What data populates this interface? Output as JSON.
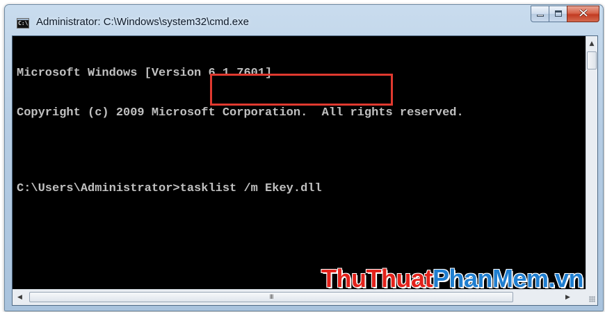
{
  "window": {
    "title": "Administrator: C:\\Windows\\system32\\cmd.exe",
    "icon": "cmd-icon",
    "icon_text": "C:\\",
    "buttons": {
      "minimize": "minimize-icon",
      "maximize": "maximize-icon",
      "close": "close-icon"
    }
  },
  "console": {
    "lines": [
      "Microsoft Windows [Version 6.1.7601]",
      "Copyright (c) 2009 Microsoft Corporation.  All rights reserved."
    ],
    "prompt": "C:\\Users\\Administrator>",
    "command": "tasklist /m Ekey.dll",
    "text_color": "#c0c0c0",
    "background": "#000000",
    "highlight_color": "#e0392f"
  },
  "scrollbars": {
    "up_arrow": "▲",
    "left_arrow": "◀",
    "right_arrow": "▶",
    "grip": "III"
  },
  "watermark": {
    "part1": "ThuThuat",
    "part2": "PhanMem",
    "part3": ".vn",
    "red": "#e3221b",
    "blue": "#1f7ed0"
  }
}
